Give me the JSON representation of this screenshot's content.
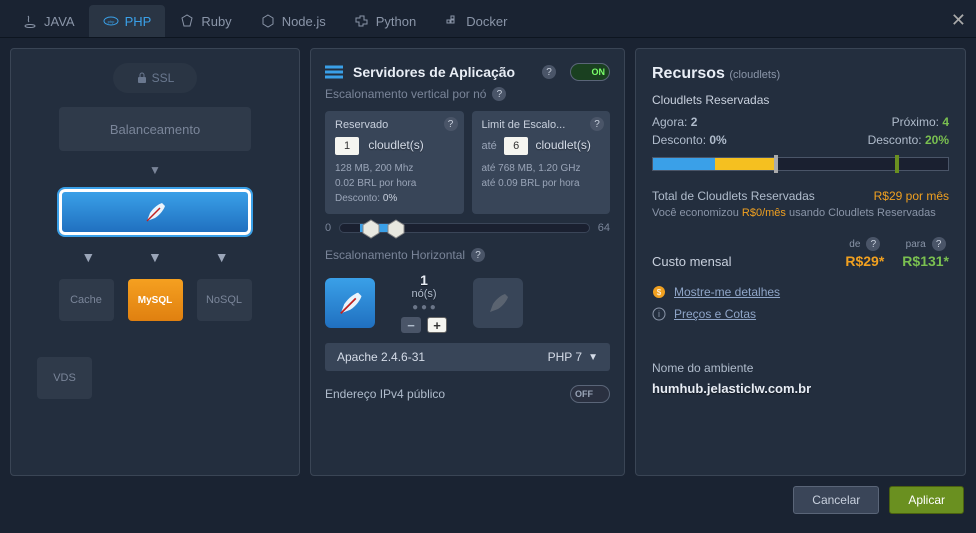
{
  "tabs": {
    "java": "JAVA",
    "php": "PHP",
    "ruby": "Ruby",
    "node": "Node.js",
    "python": "Python",
    "docker": "Docker"
  },
  "topology": {
    "ssl": "SSL",
    "balance": "Balanceamento",
    "cache": "Cache",
    "mysql": "MySQL",
    "nosql": "NoSQL",
    "vds": "VDS"
  },
  "appServers": {
    "title": "Servidores de Aplicação",
    "on_label": "ON",
    "vscale_label": "Escalonamento vertical por nó",
    "reserved": {
      "title": "Reservado",
      "value": "1",
      "unit": "cloudlet(s)",
      "meta1": "128 MB, 200 Mhz",
      "meta2": "0.02 BRL por hora",
      "discount_label": "Desconto:",
      "discount_val": "0%"
    },
    "limit": {
      "title": "Limit de Escalo...",
      "prefix": "até",
      "value": "6",
      "unit": "cloudlet(s)",
      "meta1": "até 768 MB, 1.20 GHz",
      "meta2": "até 0.09 BRL por hora"
    },
    "slider": {
      "min": "0",
      "max": "64"
    },
    "hscale_label": "Escalonamento Horizontal",
    "nodes": {
      "count": "1",
      "label": "nó(s)"
    },
    "version_left": "Apache 2.4.6-31",
    "version_right": "PHP 7",
    "ipv4_label": "Endereço IPv4 público",
    "off_label": "OFF"
  },
  "resources": {
    "title": "Recursos",
    "subtitle": "(cloudlets)",
    "reserved_title": "Cloudlets Reservadas",
    "now_label": "Agora:",
    "now_val": "2",
    "next_label": "Próximo:",
    "next_val": "4",
    "disc_label": "Desconto:",
    "disc_now": "0%",
    "disc_next": "20%",
    "total_label": "Total de Cloudlets Reservadas",
    "total_val": "R$29 por mês",
    "savings_pre": "Você economizou",
    "savings_amt": "R$0/mês",
    "savings_post": "usando Cloudlets Reservadas",
    "cost_title": "Custo mensal",
    "from_label": "de",
    "to_label": "para",
    "from_val": "R$29*",
    "to_val": "R$131*",
    "details_link": "Mostre-me detalhes",
    "quotas_link": "Preços e Cotas",
    "env_label": "Nome do ambiente",
    "env_val": "humhub.jelasticlw.com.br"
  },
  "footer": {
    "cancel": "Cancelar",
    "apply": "Aplicar"
  }
}
